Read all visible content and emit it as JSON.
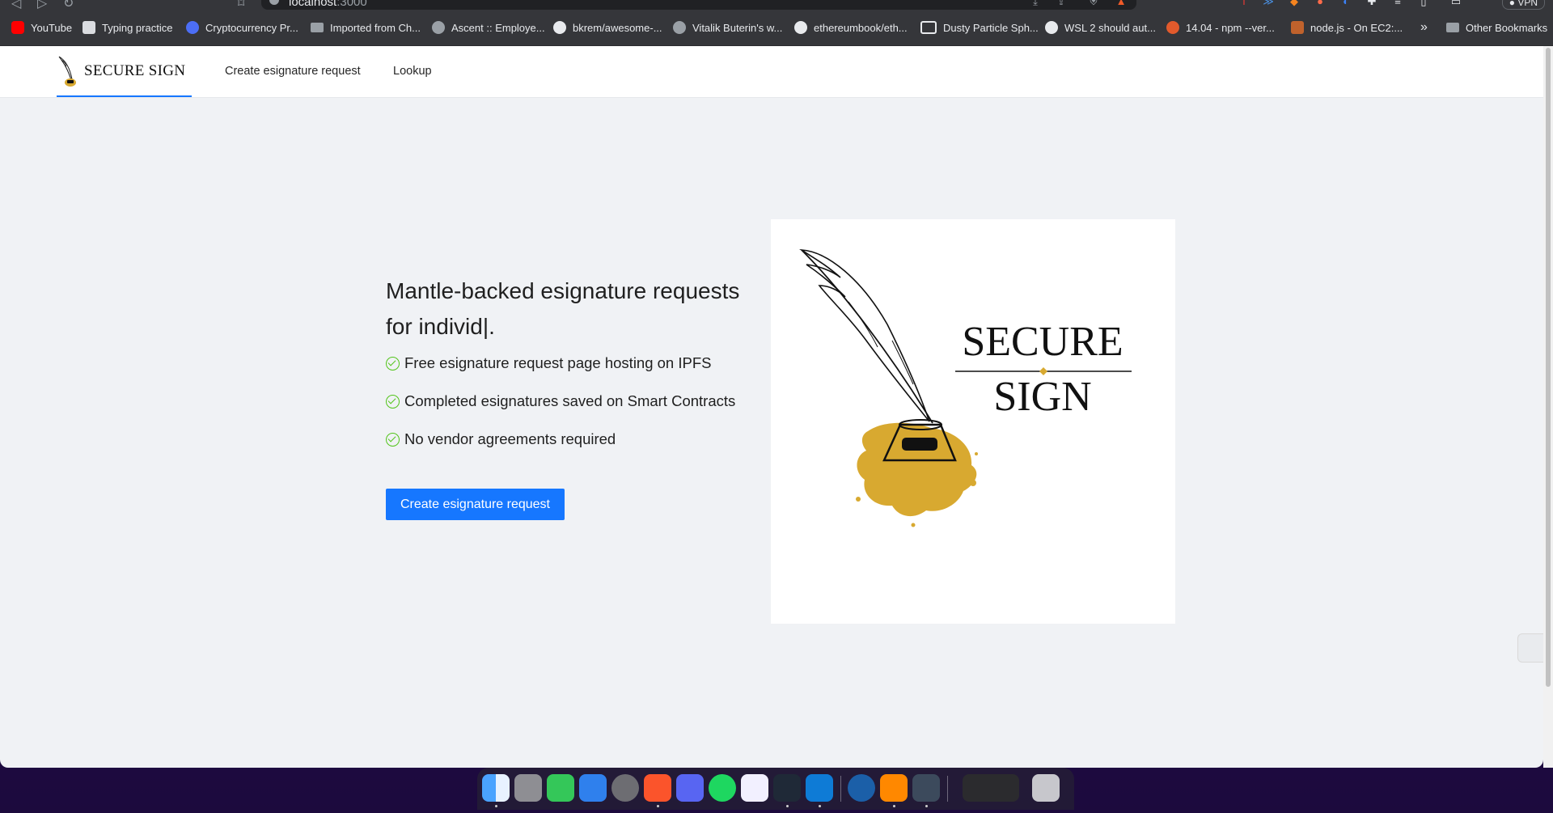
{
  "browser": {
    "url_host": "localhost",
    "url_port": ":3000",
    "vpn_label": "VPN",
    "bookmarks": [
      {
        "label": "YouTube",
        "icon": "youtube-icon"
      },
      {
        "label": "Typing practice",
        "icon": "bookmark-page-icon"
      },
      {
        "label": "Cryptocurrency Pr...",
        "icon": "coin-icon"
      },
      {
        "label": "Imported from Ch...",
        "icon": "folder-icon"
      },
      {
        "label": "Ascent :: Employe...",
        "icon": "globe-icon"
      },
      {
        "label": "bkrem/awesome-...",
        "icon": "github-icon"
      },
      {
        "label": "Vitalik Buterin's w...",
        "icon": "globe-icon"
      },
      {
        "label": "ethereumbook/eth...",
        "icon": "github-icon"
      },
      {
        "label": "Dusty Particle Sph...",
        "icon": "app-icon"
      },
      {
        "label": "WSL 2 should aut...",
        "icon": "github-icon"
      },
      {
        "label": "14.04 - npm --ver...",
        "icon": "askubuntu-icon"
      },
      {
        "label": "node.js - On EC2:...",
        "icon": "stackoverflow-icon"
      }
    ],
    "overflow_label": "»",
    "other_bookmarks": "Other Bookmarks"
  },
  "header": {
    "brand": "SECURE SIGN",
    "nav": [
      "Create esignature request",
      "Lookup"
    ]
  },
  "hero": {
    "title": "Mantle-backed esignature requests for individ|.",
    "features": [
      "Free esignature request page hosting on IPFS",
      "Completed esignatures saved on Smart Contracts",
      "No vendor agreements required"
    ],
    "cta": "Create esignature request",
    "logo": {
      "line1": "SECURE",
      "line2": "SIGN"
    }
  },
  "colors": {
    "primary": "#1677ff",
    "check": "#52c41a",
    "ink_gold": "#d8a930",
    "page_bg": "#f0f2f5"
  },
  "dock": {
    "apps": [
      "Finder",
      "Launchpad",
      "Messages",
      "Mail",
      "System Preferences",
      "Brave",
      "Discord",
      "Spotify",
      "Vectorize",
      "Terminal",
      "Visual Studio Code",
      "Proxyman",
      "VLC",
      "DaVinci Resolve",
      "Downloads",
      "Trash"
    ]
  }
}
